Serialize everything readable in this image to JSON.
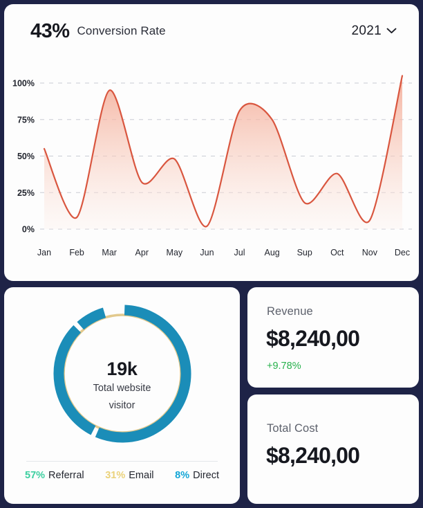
{
  "conversion": {
    "percent": "43%",
    "label": "Conversion Rate",
    "year": "2021",
    "chevron_icon": "chevron-down-icon",
    "line_color": "#d9563f",
    "fill_color_top": "#f3a48e",
    "fill_color_bottom": "#fdf2ee"
  },
  "chart_data": {
    "type": "area",
    "title": "Conversion Rate",
    "xlabel": "",
    "ylabel": "",
    "grid": true,
    "legend_position": "none",
    "ylim": [
      0,
      100
    ],
    "y_ticks": [
      "0%",
      "25%",
      "50%",
      "75%",
      "100%"
    ],
    "y_tick_values": [
      0,
      25,
      50,
      75,
      100
    ],
    "categories": [
      "Jan",
      "Feb",
      "Mar",
      "Apr",
      "May",
      "Jun",
      "Jul",
      "Aug",
      "Sup",
      "Oct",
      "Nov",
      "Dec"
    ],
    "series": [
      {
        "name": "Conversion Rate",
        "values": [
          55,
          8,
          95,
          32,
          48,
          2,
          81,
          75,
          18,
          38,
          6,
          105
        ]
      }
    ]
  },
  "visitors": {
    "value": "19k",
    "sub_line1": "Total website",
    "sub_line2": "visitor",
    "donut": {
      "type": "pie",
      "ring_color": "#e2c98d",
      "segments": [
        {
          "label": "Referral",
          "percent": 57,
          "display": "57%",
          "color": "#1b8db8",
          "legend_color": "#3ccfa0"
        },
        {
          "label": "Email",
          "percent": 31,
          "display": "31%",
          "color": "#1b8db8",
          "legend_color": "#ebd27a"
        },
        {
          "label": "Direct",
          "percent": 8,
          "display": "8%",
          "color": "#1b8db8",
          "legend_color": "#12a5d6"
        }
      ]
    },
    "legend": [
      {
        "percent": "57%",
        "name": "Referral",
        "color": "#3ccfa0"
      },
      {
        "percent": "31%",
        "name": "Email",
        "color": "#ebd27a"
      },
      {
        "percent": "8%",
        "name": "Direct",
        "color": "#12a5d6"
      }
    ]
  },
  "stats": [
    {
      "title": "Revenue",
      "value": "$8,240,00",
      "delta": "+9.78%",
      "delta_color": "#27b14c"
    },
    {
      "title": "Total Cost",
      "value": "$8,240,00",
      "delta": null
    }
  ]
}
